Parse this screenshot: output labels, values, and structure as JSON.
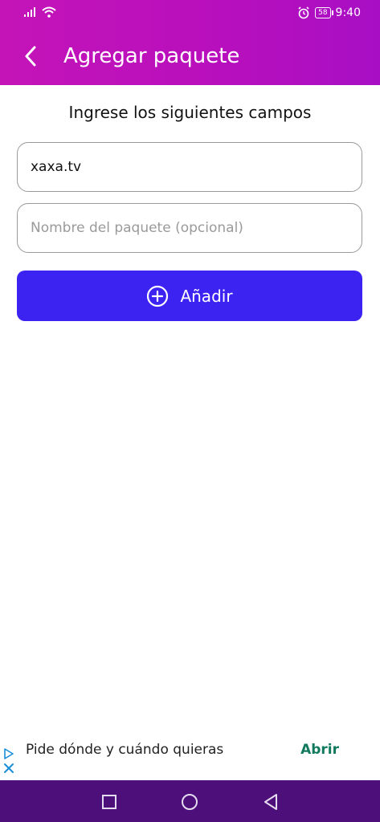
{
  "statusbar": {
    "time": "9:40",
    "battery": "58",
    "icons": [
      "signal-icon",
      "wifi-icon",
      "alarm-icon",
      "battery-icon"
    ]
  },
  "appbar": {
    "title": "Agregar paquete",
    "back_icon": "chevron-left-icon"
  },
  "form": {
    "instruction": "Ingrese los siguientes campos",
    "field_url_value": "xaxa.tv",
    "field_name_placeholder": "Nombre del paquete (opcional)",
    "add_label": "Añadir",
    "add_icon": "plus-circle-icon"
  },
  "ad": {
    "text": "Pide dónde y cuándo quieras",
    "action": "Abrir"
  },
  "navbar": {
    "buttons": [
      "square-icon",
      "circle-icon",
      "triangle-back-icon"
    ]
  },
  "colors": {
    "header": "#b70fbd",
    "primary_button": "#3d23f2",
    "nav": "#4d0f7a",
    "ad_action": "#117a5e"
  }
}
